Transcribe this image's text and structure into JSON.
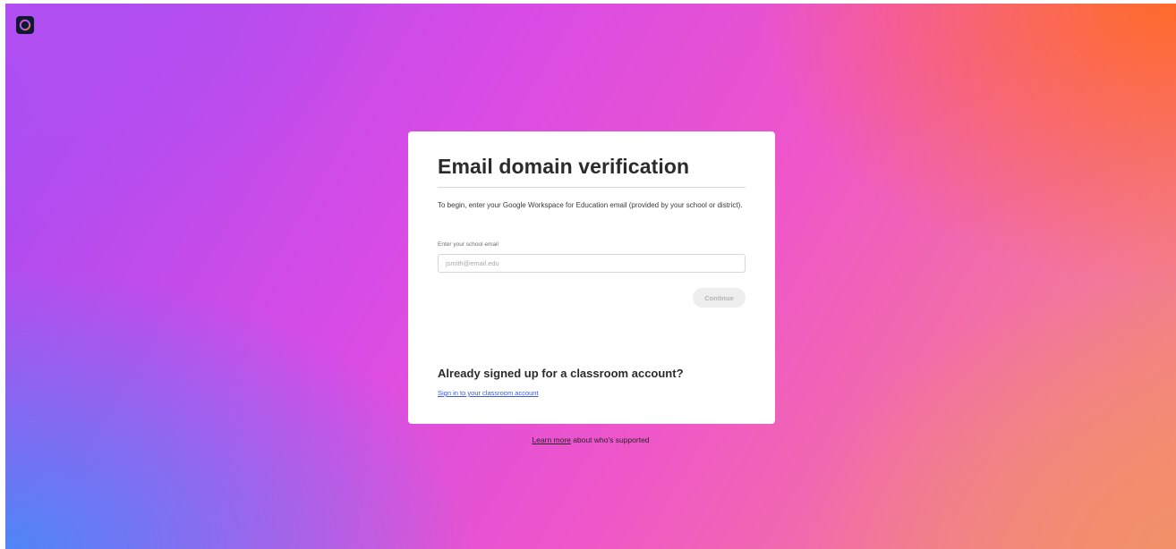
{
  "app": {
    "logo_icon": "creative-cloud-icon",
    "logo_bg_color": "#0e1a2e"
  },
  "card": {
    "title": "Email domain verification",
    "description": "To begin, enter your Google Workspace for Education email (provided by your school or district).",
    "email_label": "Enter your school email",
    "email_placeholder": "jsmith@email.edu",
    "email_value": "",
    "continue_label": "Continue",
    "continue_disabled": true,
    "subheading": "Already signed up for a classroom account?",
    "signin_link": "Sign in to your classroom account",
    "link_color": "#3d5ad8"
  },
  "footer": {
    "learn_more_link": "Learn more",
    "learn_more_suffix": " about who's supported"
  }
}
